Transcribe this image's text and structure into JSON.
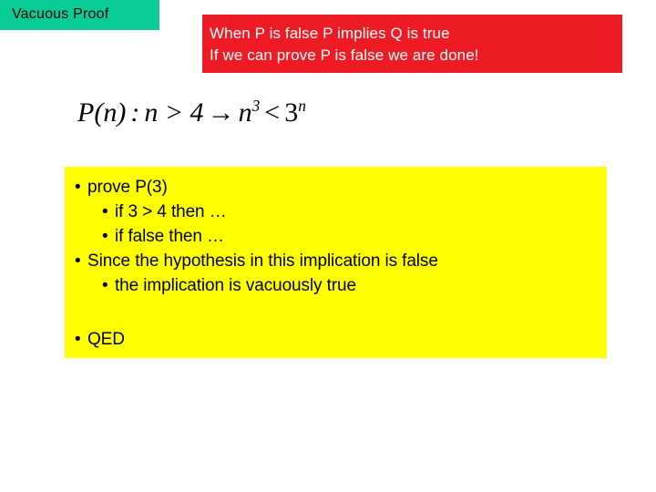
{
  "slide": {
    "title_chip": {
      "label": "Vacuous Proof",
      "bg_color": "#0ACD96",
      "text_color": "#000000"
    },
    "banner": {
      "bg_color": "#ED1C24",
      "text_color": "#FFFFFF",
      "line1": "When P is false  P implies Q is true",
      "line2": "If we can prove P is false we are done!"
    },
    "formula": {
      "plain": "P(n) : n > 4 → n3 < 3n",
      "lhs_label": "P(n)",
      "colon": ":",
      "hypothesis": "n > 4",
      "arrow": "→",
      "base1": "n",
      "exp1": "3",
      "relation": "<",
      "base2": "3",
      "exp2": "n"
    },
    "content_box": {
      "bg_color": "#FFFF00",
      "text_color": "#000000",
      "bullet_glyph": "•",
      "items": [
        {
          "level": 1,
          "text": "prove P(3)"
        },
        {
          "level": 2,
          "text": "if 3 > 4 then …"
        },
        {
          "level": 2,
          "text": "if false then …"
        },
        {
          "level": 1,
          "text": "Since the hypothesis in this implication is false"
        },
        {
          "level": 2,
          "text": "the implication is vacuously true"
        },
        {
          "level": 1,
          "text": "QED"
        }
      ]
    }
  }
}
